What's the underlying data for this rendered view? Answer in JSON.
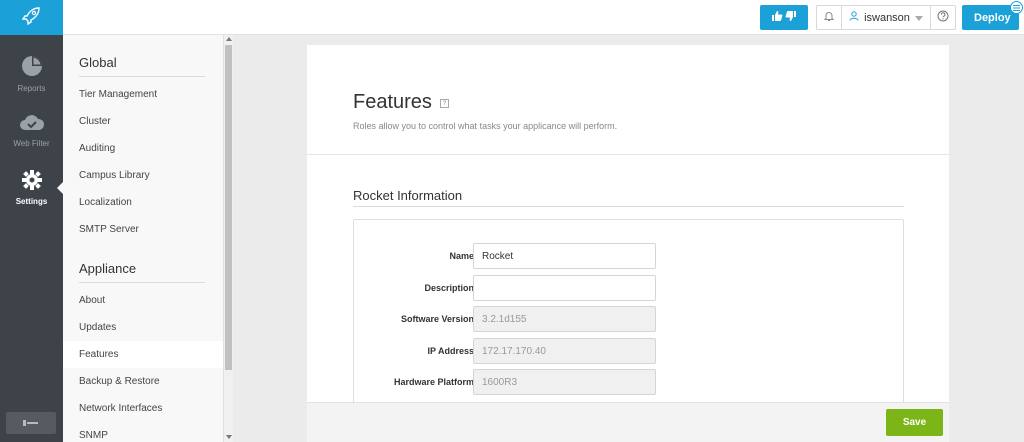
{
  "rail": {
    "logo_icon": "rocket-icon",
    "items": [
      {
        "label": "Reports",
        "icon": "pie-chart-icon",
        "active": false
      },
      {
        "label": "Web Filter",
        "icon": "cloud-check-icon",
        "active": false
      },
      {
        "label": "Settings",
        "icon": "gear-icon",
        "active": true
      }
    ],
    "bottom_icon": "collapse-icon"
  },
  "header": {
    "feedback_icons": [
      "thumbs-up-icon",
      "thumbs-down-icon"
    ],
    "notifications_icon": "bell-icon",
    "username": "iswanson",
    "user_icon": "user-icon",
    "help_icon": "question-icon",
    "deploy_label": "Deploy",
    "deploy_badge_icon": "list-icon"
  },
  "sidebar": {
    "global_heading": "Global",
    "global_items": [
      "Tier Management",
      "Cluster",
      "Auditing",
      "Campus Library",
      "Localization",
      "SMTP Server"
    ],
    "appliance_heading": "Appliance",
    "appliance_items": [
      "About",
      "Updates",
      "Features",
      "Backup & Restore",
      "Network Interfaces",
      "SNMP"
    ],
    "selected": "Features"
  },
  "main": {
    "title": "Features",
    "subtitle": "Roles allow you to control what tasks your applicance will perform.",
    "section_title": "Rocket Information",
    "fields": [
      {
        "label": "Name",
        "value": "Rocket",
        "placeholder": "",
        "disabled": false
      },
      {
        "label": "Description",
        "value": "",
        "placeholder": "",
        "disabled": false
      },
      {
        "label": "Software Version",
        "value": "3.2.1d155",
        "placeholder": "",
        "disabled": true
      },
      {
        "label": "IP Address",
        "value": "172.17.170.40",
        "placeholder": "",
        "disabled": true
      },
      {
        "label": "Hardware Platform",
        "value": "1600R3",
        "placeholder": "",
        "disabled": true
      }
    ],
    "save_label": "Save"
  },
  "colors": {
    "accent": "#1ba1d8",
    "rail_bg": "#3d4348",
    "save_green": "#7cb518"
  }
}
